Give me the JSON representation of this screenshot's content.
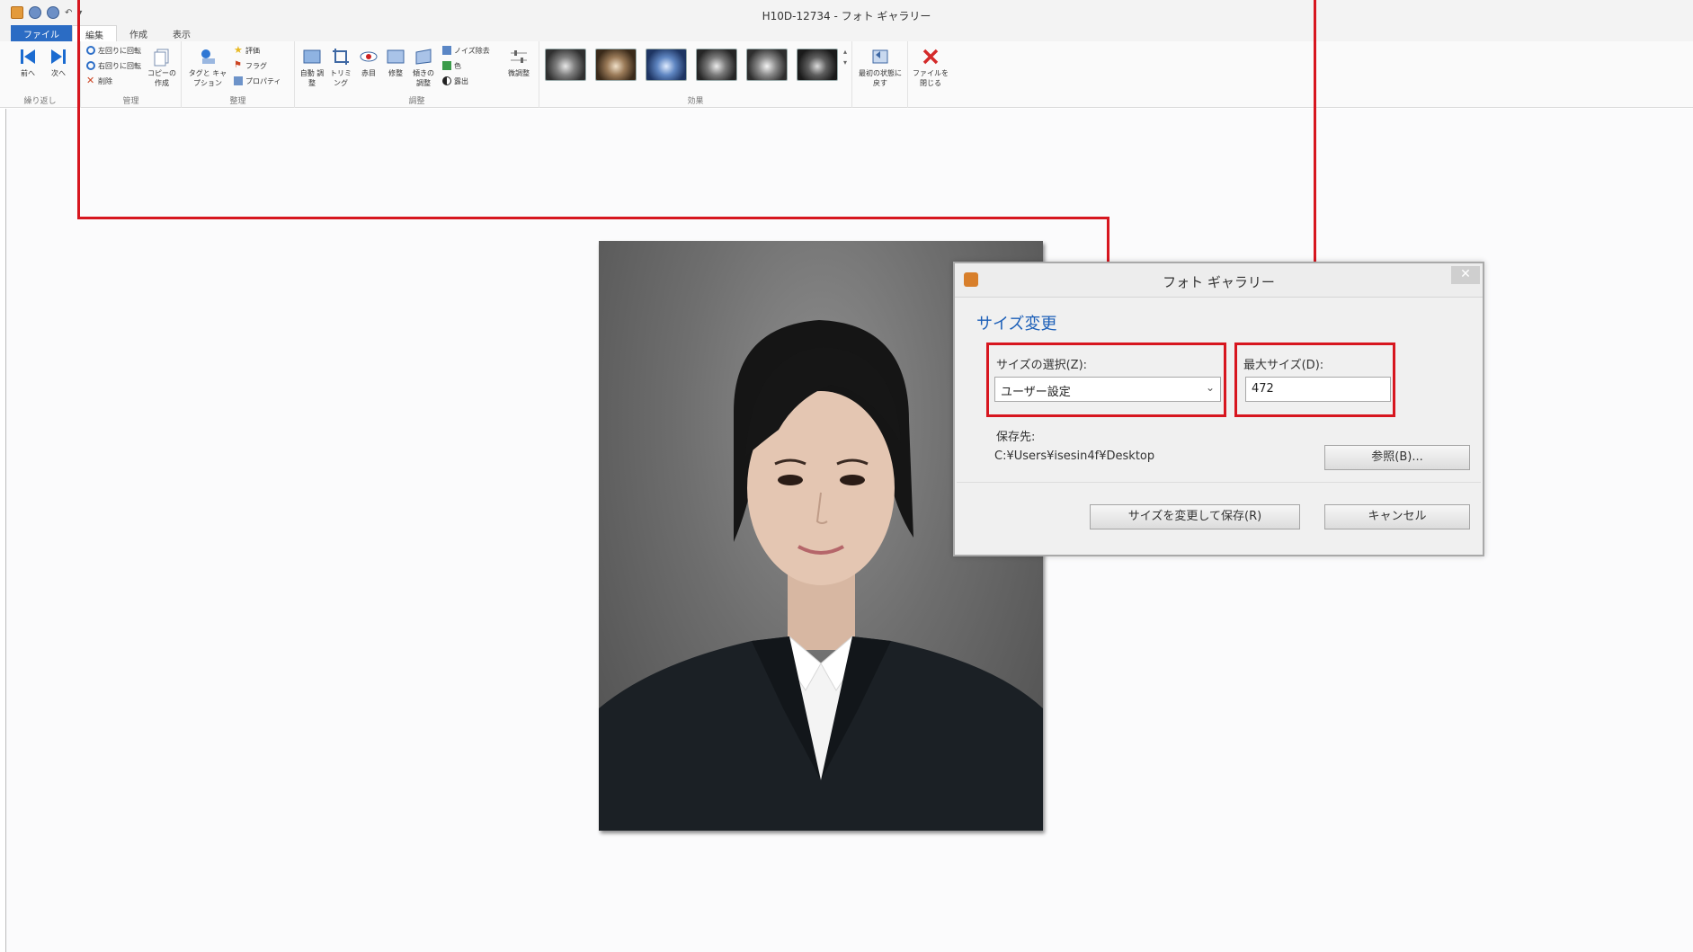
{
  "window": {
    "title": "H10D-12734 - フォト ギャラリー",
    "tabs": [
      "ファイル",
      "編集",
      "作成",
      "表示"
    ]
  },
  "ribbon": {
    "groups": {
      "navigate": {
        "label": "繰り返し",
        "prev": "前へ",
        "next": "次へ"
      },
      "manage": {
        "label": "管理",
        "rotate_left": "左回りに回転",
        "rotate_right": "右回りに回転",
        "delete": "削除",
        "copy": "コピーの作成"
      },
      "organize": {
        "label": "整理",
        "tags": "タグと キャプション",
        "rating": "評価",
        "flag": "フラグ",
        "properties": "プロパティ"
      },
      "adjust": {
        "label": "調整",
        "auto_adjust": "自動 調整",
        "crop": "トリミング",
        "red_eye": "赤目",
        "retouch": "修整",
        "straighten": "傾きの 調整",
        "noise": "ノイズ除去",
        "color": "色",
        "exposure": "露出",
        "fine_tune": "微調整"
      },
      "effects": {
        "label": "効果"
      },
      "revert": {
        "label": "最初の状態に戻す"
      },
      "close_file": {
        "label": "ファイルを閉じる"
      }
    }
  },
  "dialog": {
    "title": "フォト ギャラリー",
    "heading": "サイズ変更",
    "size_select_label": "サイズの選択(Z):",
    "size_select_value": "ユーザー設定",
    "max_size_label": "最大サイズ(D):",
    "max_size_value": "472",
    "save_location_label": "保存先:",
    "save_location_value": "C:¥Users¥isesin4f¥Desktop",
    "browse_button": "参照(B)...",
    "resize_save_button": "サイズを変更して保存(R)",
    "cancel_button": "キャンセル"
  },
  "colors": {
    "annotation": "#d7161f",
    "accent": "#1c5fb8",
    "file_tab": "#2b6cc4"
  }
}
